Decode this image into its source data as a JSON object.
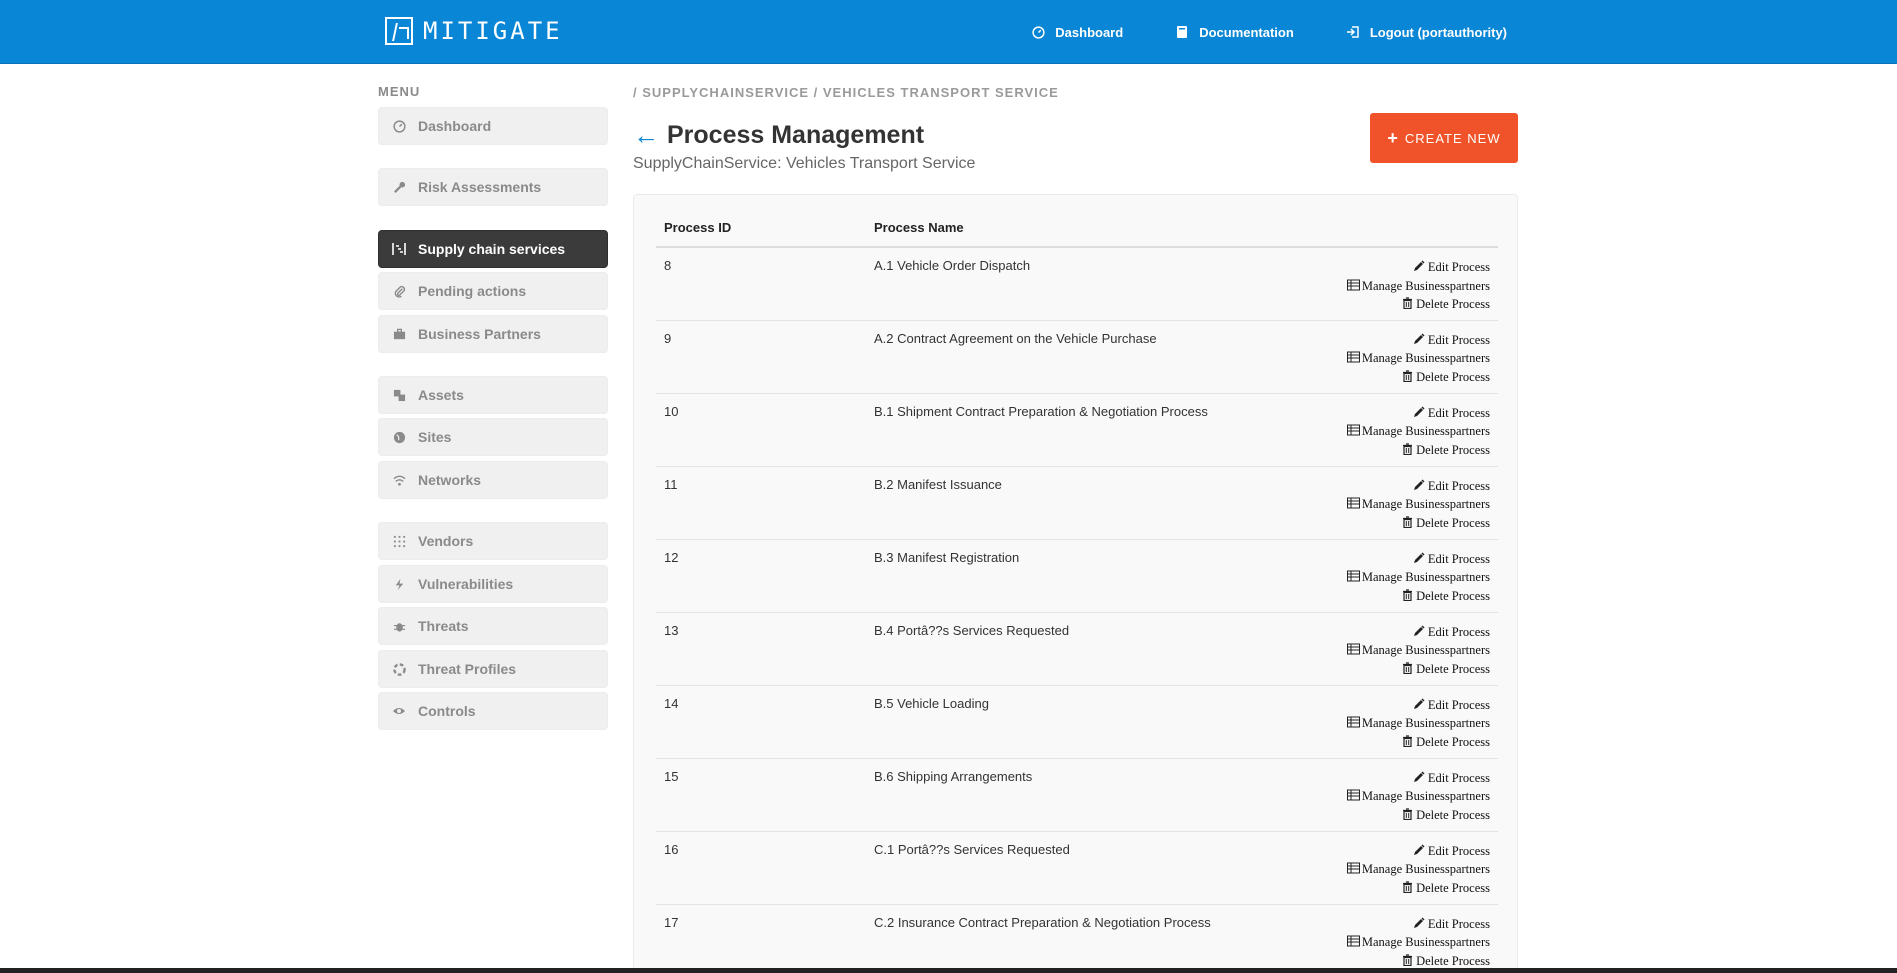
{
  "header": {
    "logo_text": "MITIGATE",
    "nav": [
      {
        "label": "Dashboard",
        "icon": "dashboard-icon"
      },
      {
        "label": "Documentation",
        "icon": "book-icon"
      },
      {
        "label": "Logout (portauthority)",
        "icon": "logout-icon"
      }
    ]
  },
  "sidebar": {
    "title": "MENU",
    "items": [
      {
        "label": "Dashboard",
        "icon": "dashboard-icon"
      },
      {
        "label": "Risk Assessments",
        "icon": "wrench-icon"
      },
      {
        "label": "Supply chain services",
        "icon": "supply-chain-icon",
        "active": true
      },
      {
        "label": "Pending actions",
        "icon": "paperclip-icon"
      },
      {
        "label": "Business Partners",
        "icon": "briefcase-icon"
      },
      {
        "label": "Assets",
        "icon": "assets-icon"
      },
      {
        "label": "Sites",
        "icon": "globe-icon"
      },
      {
        "label": "Networks",
        "icon": "wifi-icon"
      },
      {
        "label": "Vendors",
        "icon": "grid-icon"
      },
      {
        "label": "Vulnerabilities",
        "icon": "bolt-icon"
      },
      {
        "label": "Threats",
        "icon": "bug-icon"
      },
      {
        "label": "Threat Profiles",
        "icon": "life-ring-icon"
      },
      {
        "label": "Controls",
        "icon": "eye-icon"
      }
    ]
  },
  "breadcrumb": "/ SUPPLYCHAINSERVICE / VEHICLES TRANSPORT SERVICE",
  "page": {
    "back": "←",
    "title": "Process Management",
    "subtitle": "SupplyChainService: Vehicles Transport Service",
    "create_label": "CREATE NEW",
    "create_plus": "+"
  },
  "table": {
    "headers": [
      "Process ID",
      "Process Name"
    ],
    "action_labels": {
      "edit": "Edit Process",
      "manage": "Manage Businesspartners",
      "delete": "Delete Process"
    },
    "rows": [
      {
        "id": "8",
        "name": "A.1 Vehicle Order Dispatch"
      },
      {
        "id": "9",
        "name": "A.2 Contract Agreement on the Vehicle Purchase"
      },
      {
        "id": "10",
        "name": "B.1 Shipment Contract Preparation & Negotiation Process"
      },
      {
        "id": "11",
        "name": "B.2 Manifest Issuance"
      },
      {
        "id": "12",
        "name": "B.3 Manifest Registration"
      },
      {
        "id": "13",
        "name": "B.4 Portâ??s Services Requested"
      },
      {
        "id": "14",
        "name": "B.5 Vehicle Loading"
      },
      {
        "id": "15",
        "name": "B.6 Shipping Arrangements"
      },
      {
        "id": "16",
        "name": "C.1 Portâ??s Services Requested"
      },
      {
        "id": "17",
        "name": "C.2 Insurance Contract Preparation & Negotiation Process"
      }
    ]
  },
  "colors": {
    "header_bg": "#0a86d6",
    "accent_button": "#f0532a",
    "active_menu": "#3b3b3b"
  }
}
